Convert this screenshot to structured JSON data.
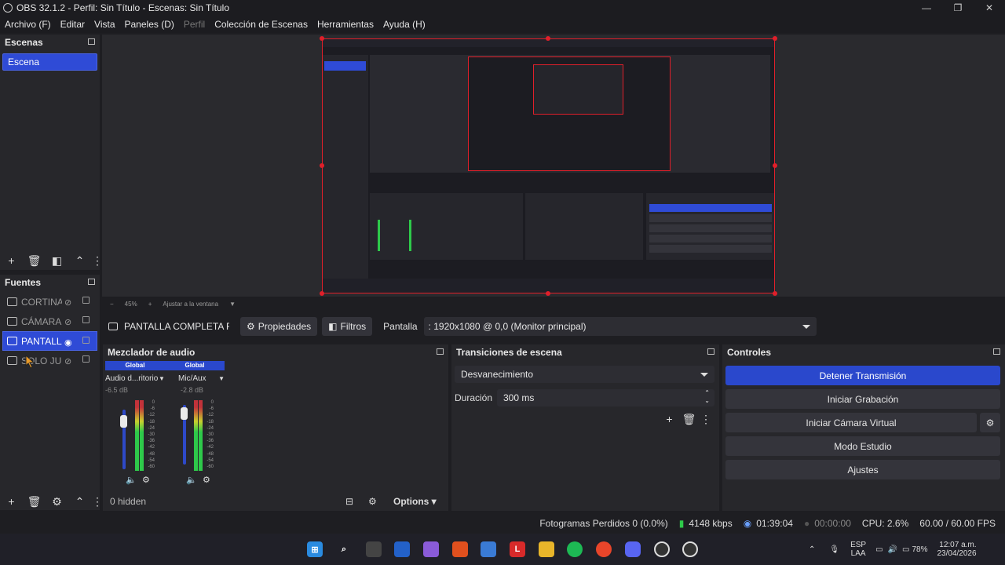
{
  "window": {
    "title": "OBS 32.1.2 - Perfil: Sin Título - Escenas: Sin Título"
  },
  "menu": [
    {
      "label": "Archivo (F)",
      "disabled": false
    },
    {
      "label": "Editar",
      "disabled": false
    },
    {
      "label": "Vista",
      "disabled": false
    },
    {
      "label": "Paneles (D)",
      "disabled": false
    },
    {
      "label": "Perfil",
      "disabled": true
    },
    {
      "label": "Colección de Escenas",
      "disabled": false
    },
    {
      "label": "Herramientas",
      "disabled": false
    },
    {
      "label": "Ayuda (H)",
      "disabled": false
    }
  ],
  "scenes": {
    "title": "Escenas",
    "items": [
      "Escena"
    ]
  },
  "sources": {
    "title": "Fuentes",
    "items": [
      {
        "label": "CORTINA",
        "icon": "image-icon",
        "visible": false
      },
      {
        "label": "CÁMARA",
        "icon": "camera-icon",
        "visible": false
      },
      {
        "label": "PANTALLA",
        "icon": "monitor-icon",
        "visible": true
      },
      {
        "label": "SOLO JUEGO",
        "icon": "gamepad-icon",
        "visible": false
      }
    ]
  },
  "preview": {
    "zoom": "45%",
    "fit_label": "Ajustar a la ventana"
  },
  "source_toolbar": {
    "source_name": "PANTALLA COMPLETA FULL",
    "properties": "Propiedades",
    "filters": "Filtros",
    "display_label": "Pantalla",
    "display_value": ": 1920x1080 @ 0,0 (Monitor principal)"
  },
  "mixer": {
    "title": "Mezclador de audio",
    "channels": [
      {
        "header": "Global",
        "name": "Audio d...ritorio",
        "db": "-6.5 dB",
        "level": 0.78
      },
      {
        "header": "Global",
        "name": "Mic/Aux",
        "db": "-2.8 dB",
        "level": 0.88
      }
    ],
    "ticks": [
      "0",
      "-6",
      "-12",
      "-18",
      "-24",
      "-30",
      "-36",
      "-42",
      "-48",
      "-54",
      "-60"
    ],
    "hidden_label": "0 hidden",
    "options_label": "Options"
  },
  "transitions": {
    "title": "Transiciones de escena",
    "selected": "Desvanecimiento",
    "duration_label": "Duración",
    "duration_value": "300 ms"
  },
  "controls": {
    "title": "Controles",
    "buttons": [
      "Detener Transmisión",
      "Iniciar Grabación",
      "Iniciar Cámara Virtual",
      "Modo Estudio",
      "Ajustes"
    ]
  },
  "status": {
    "dropped": "Fotogramas Perdidos 0 (0.0%)",
    "bitrate": "4148 kbps",
    "stream_time": "01:39:04",
    "rec_time": "00:00:00",
    "cpu": "CPU: 2.6%",
    "fps": "60.00 / 60.00 FPS"
  },
  "taskbar": {
    "lang_top": "ESP",
    "lang_bottom": "LAA",
    "battery": "78%",
    "time": "12:07 a.m.",
    "date": "23/04/2026"
  },
  "colors": {
    "accent": "#2a48cc",
    "canvas_border": "#e01f2a",
    "meter_green": "#2ec94a"
  }
}
